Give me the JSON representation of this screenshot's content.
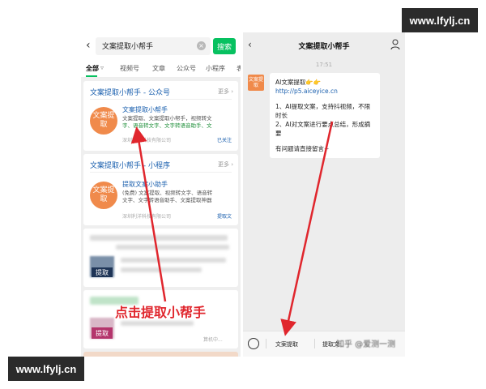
{
  "watermark": {
    "text": "www.lfylj.cn"
  },
  "colors": {
    "accent": "#07c160",
    "link": "#1a5fae",
    "avatar": "#f08a4b",
    "annotation": "#e0262d"
  },
  "left_phone": {
    "search": {
      "query": "文案提取小帮手",
      "button": "搜索"
    },
    "tabs": [
      "全部",
      "视频号",
      "文章",
      "公众号",
      "小程序",
      "表"
    ],
    "official_card": {
      "title": "文案提取小帮手 - 公众号",
      "more": "更多",
      "avatar_text": "文案提取",
      "name": "文案提取小帮手",
      "desc_line1": "文案提取、文案提取小帮手，视频转文",
      "desc_line2": "字、语音转文字、文字转语音助手、文",
      "meta": "深圳利洋科技有限公司",
      "tag": "已关注"
    },
    "miniapp_card": {
      "title": "文案提取小帮手 - 小程序",
      "more": "更多",
      "avatar_text": "文案提取",
      "name": "提取文案小助手",
      "desc_line1": "(免费) 文案提取、视频转文字、语音转",
      "desc_line2": "文字、文字转语音助手、文案提取神器",
      "meta": "深圳利洋科技有限公司",
      "tag": "提取文"
    },
    "blur_card_1": {
      "badge": "提取"
    },
    "blur_card_2": {
      "badge": "提取",
      "meta": "算机中..."
    },
    "annotation": "点击提取小帮手"
  },
  "right_phone": {
    "title": "文案提取小帮手",
    "time": "17:51",
    "avatar_text": "文案提取",
    "bubble": {
      "line1_prefix": "AI文案提取👉👉",
      "line1_link": "http://p5.aiceyice.cn",
      "line2": "1、AI提取文案，支持抖视频，不限时长",
      "line3": "2、AI对文案进行要点总结，形成摘要",
      "line4": "有问题请直接留言~"
    },
    "menu": {
      "item1": "文案提取",
      "item2": "提取文",
      "zhihu": "知乎 @爱测一测"
    }
  }
}
